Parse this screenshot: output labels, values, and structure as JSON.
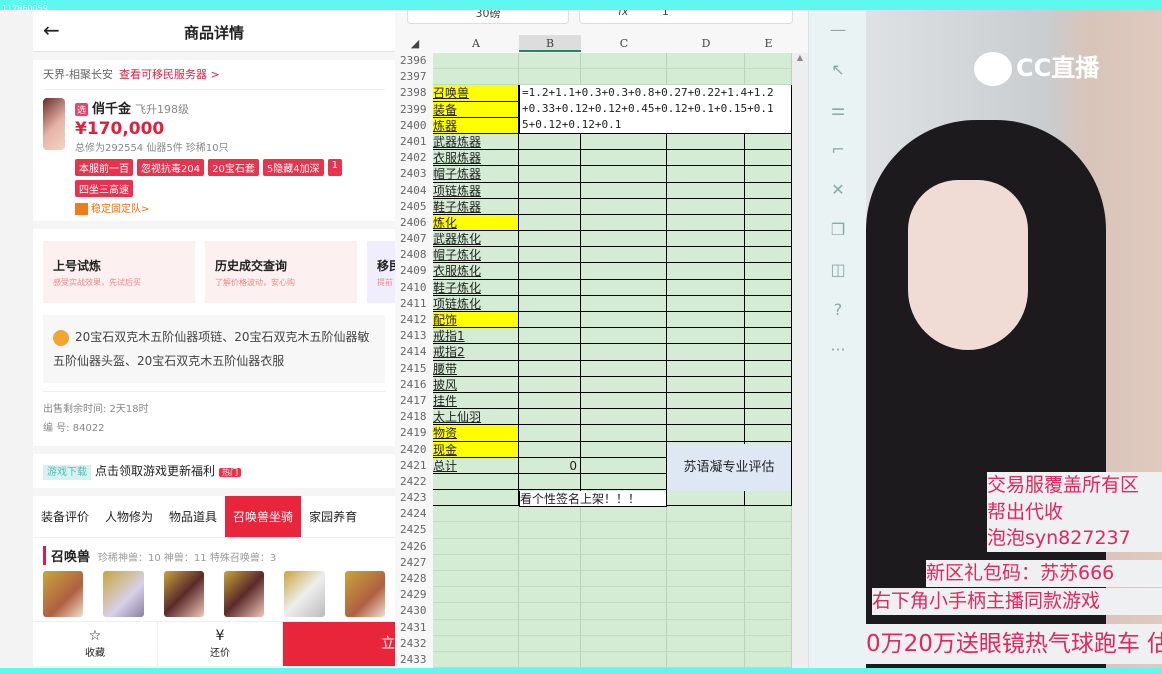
{
  "window": {
    "title": "117860059"
  },
  "app": {
    "title": "商品详情",
    "back": "←",
    "server": "天界-相聚长安",
    "server_link": "查看可移民服务器 >",
    "role": {
      "badge": "选",
      "name": "俏千金",
      "level": "飞升198级",
      "price": "¥170,000",
      "stats": "总修为292554  仙器5件  珍稀10只",
      "tags": [
        "本服前一百",
        "忽视抗毒204",
        "20宝石套",
        "5隐藏4加深",
        "1",
        "四坐三高速"
      ],
      "team": "稳定固定队>"
    },
    "services": [
      {
        "title": "上号试炼",
        "sub": "感受实战效果，先试后买"
      },
      {
        "title": "历史成交查询",
        "sub": "了解价格波动，安心购"
      },
      {
        "title": "移民",
        "sub": "提前"
      }
    ],
    "highlight": "20宝石双克木五阶仙器项链、20宝石双克木五阶仙器敏五阶仙器头盔、20宝石双克木五阶仙器衣服",
    "remaining": "出售剩余时间: 2天18时",
    "serial": "编 号: 84022",
    "download": {
      "tag": "游戏下载",
      "text": "点击领取游戏更新福利",
      "hot": "热门"
    },
    "tabs": [
      "装备评价",
      "人物修为",
      "物品道具",
      "召唤兽坐骑",
      "家园养育"
    ],
    "pets": {
      "title": "召唤兽",
      "stats": "珍稀神兽：10   神兽：11   特殊召唤兽：3"
    },
    "bottom": {
      "fav": "收藏",
      "bargain": "还价",
      "buy": "立"
    }
  },
  "sheet": {
    "font_size_box": "30磅",
    "fx": "fx",
    "formula_value": "1",
    "columns": [
      "A",
      "B",
      "C",
      "D",
      "E"
    ],
    "rows": [
      {
        "n": "2396",
        "a": ""
      },
      {
        "n": "2397",
        "a": ""
      },
      {
        "n": "2398",
        "a": "召唤兽",
        "y": true
      },
      {
        "n": "2399",
        "a": "装备",
        "y": true
      },
      {
        "n": "2400",
        "a": "炼器",
        "y": true
      },
      {
        "n": "2401",
        "a": "武器炼器"
      },
      {
        "n": "2402",
        "a": "衣服炼器"
      },
      {
        "n": "2403",
        "a": "帽子炼器"
      },
      {
        "n": "2404",
        "a": "项链炼器"
      },
      {
        "n": "2405",
        "a": "鞋子炼器"
      },
      {
        "n": "2406",
        "a": "炼化",
        "y": true
      },
      {
        "n": "2407",
        "a": "武器炼化"
      },
      {
        "n": "2408",
        "a": "帽子炼化"
      },
      {
        "n": "2409",
        "a": "衣服炼化"
      },
      {
        "n": "2410",
        "a": "鞋子炼化"
      },
      {
        "n": "2411",
        "a": "项链炼化"
      },
      {
        "n": "2412",
        "a": "配饰",
        "y": true
      },
      {
        "n": "2413",
        "a": "戒指1"
      },
      {
        "n": "2414",
        "a": "戒指2"
      },
      {
        "n": "2415",
        "a": "腰带"
      },
      {
        "n": "2416",
        "a": "披风"
      },
      {
        "n": "2417",
        "a": "挂件"
      },
      {
        "n": "2418",
        "a": "太上仙羽"
      },
      {
        "n": "2419",
        "a": "物资",
        "y": true
      },
      {
        "n": "2420",
        "a": "现金",
        "y": true
      },
      {
        "n": "2421",
        "a": "总计",
        "b": "0"
      },
      {
        "n": "2422",
        "a": ""
      },
      {
        "n": "2423",
        "a": ""
      },
      {
        "n": "2424"
      },
      {
        "n": "2425"
      },
      {
        "n": "2426"
      },
      {
        "n": "2427"
      },
      {
        "n": "2428"
      },
      {
        "n": "2429"
      },
      {
        "n": "2430"
      },
      {
        "n": "2431"
      },
      {
        "n": "2432"
      },
      {
        "n": "2433"
      }
    ],
    "editing_formula": [
      "=1.2+1.1+0.3+0.3+0.8+0.27+0.22+1.4+1.2",
      "+0.33+0.12+0.12+0.45+0.12+0.1+0.15+0.1",
      "5+0.12+0.12+0.1"
    ],
    "eval_label": "苏语凝专业评估",
    "sign_label": "看个性签名上架！！！"
  },
  "stream": {
    "logo": "CC直播",
    "overlays": [
      "交易服覆盖所有区",
      "帮出代收",
      "泡泡syn827237",
      "新区礼包码：苏苏666",
      "右下角小手柄主播同款游戏",
      "0万20万送眼镜热气球跑车  估"
    ]
  }
}
